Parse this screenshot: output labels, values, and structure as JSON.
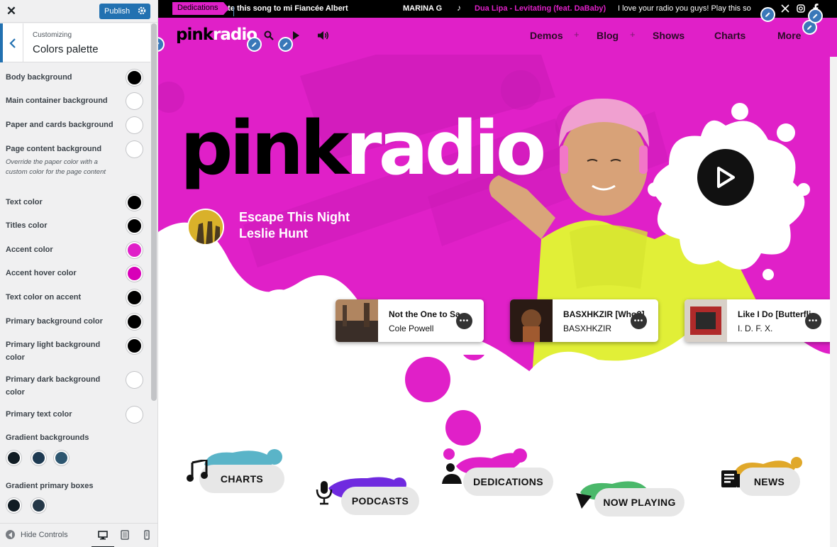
{
  "sidebar": {
    "close_glyph": "✕",
    "publish_label": "Publish",
    "breadcrumb": "Customizing",
    "section_title": "Colors palette",
    "options": [
      {
        "label": "Body background",
        "color": "#000000"
      },
      {
        "label": "Main container background",
        "color": "#ffffff"
      },
      {
        "label": "Paper and cards background",
        "color": "#ffffff"
      },
      {
        "label": "Page content background",
        "description": "Override the paper color with a custom color for the page content",
        "color": "#ffffff"
      },
      {
        "label": "Text color",
        "color": "#000000"
      },
      {
        "label": "Titles color",
        "color": "#000000"
      },
      {
        "label": "Accent color",
        "color": "#e020c8"
      },
      {
        "label": "Accent hover color",
        "color": "#d800b8"
      },
      {
        "label": "Text color on accent",
        "color": "#000000"
      },
      {
        "label": "Primary background color",
        "color": "#000000"
      },
      {
        "label": "Primary light background color",
        "color": "#000000"
      },
      {
        "label": "Primary dark background color",
        "color": "#ffffff"
      },
      {
        "label": "Primary text color",
        "color": "#ffffff"
      }
    ],
    "gradient_backgrounds": {
      "label": "Gradient backgrounds",
      "colors": [
        "#111c24",
        "#1e3a52",
        "#2d5670"
      ]
    },
    "gradient_primary_boxes": {
      "label": "Gradient primary boxes",
      "colors": [
        "#111c24",
        "#253848"
      ]
    },
    "hide_controls_label": "Hide Controls"
  },
  "preview": {
    "ticker": {
      "label": "Dedications",
      "items": [
        "ate this song to mi Fiancée Albert",
        "MARINA G",
        "Dua Lipa - Levitating (feat. DaBaby)",
        "I love your radio you guys! Play this so"
      ]
    },
    "logo_small": {
      "word1": "pink",
      "word2": "radio"
    },
    "nav_items": [
      "Demos",
      "Blog",
      "Shows",
      "Charts",
      "More"
    ],
    "hero": {
      "logo_word1": "pink",
      "logo_word2": "radio",
      "now_playing_title": "Escape This Night",
      "now_playing_artist": "Leslie Hunt"
    },
    "tracks": [
      {
        "title": "Not the One to Sa",
        "artist": "Cole Powell"
      },
      {
        "title": "BASXHKZIR [Who?]",
        "artist": "BASXHKZIR"
      },
      {
        "title": "Like I Do [Butterfli",
        "artist": "I. D. F. X."
      }
    ],
    "categories": [
      "CHARTS",
      "PODCASTS",
      "DEDICATIONS",
      "NOW PLAYING",
      "NEWS"
    ]
  },
  "colors": {
    "accent": "#e020c8",
    "lime": "#e7f03c",
    "wp_blue": "#2271b1"
  }
}
